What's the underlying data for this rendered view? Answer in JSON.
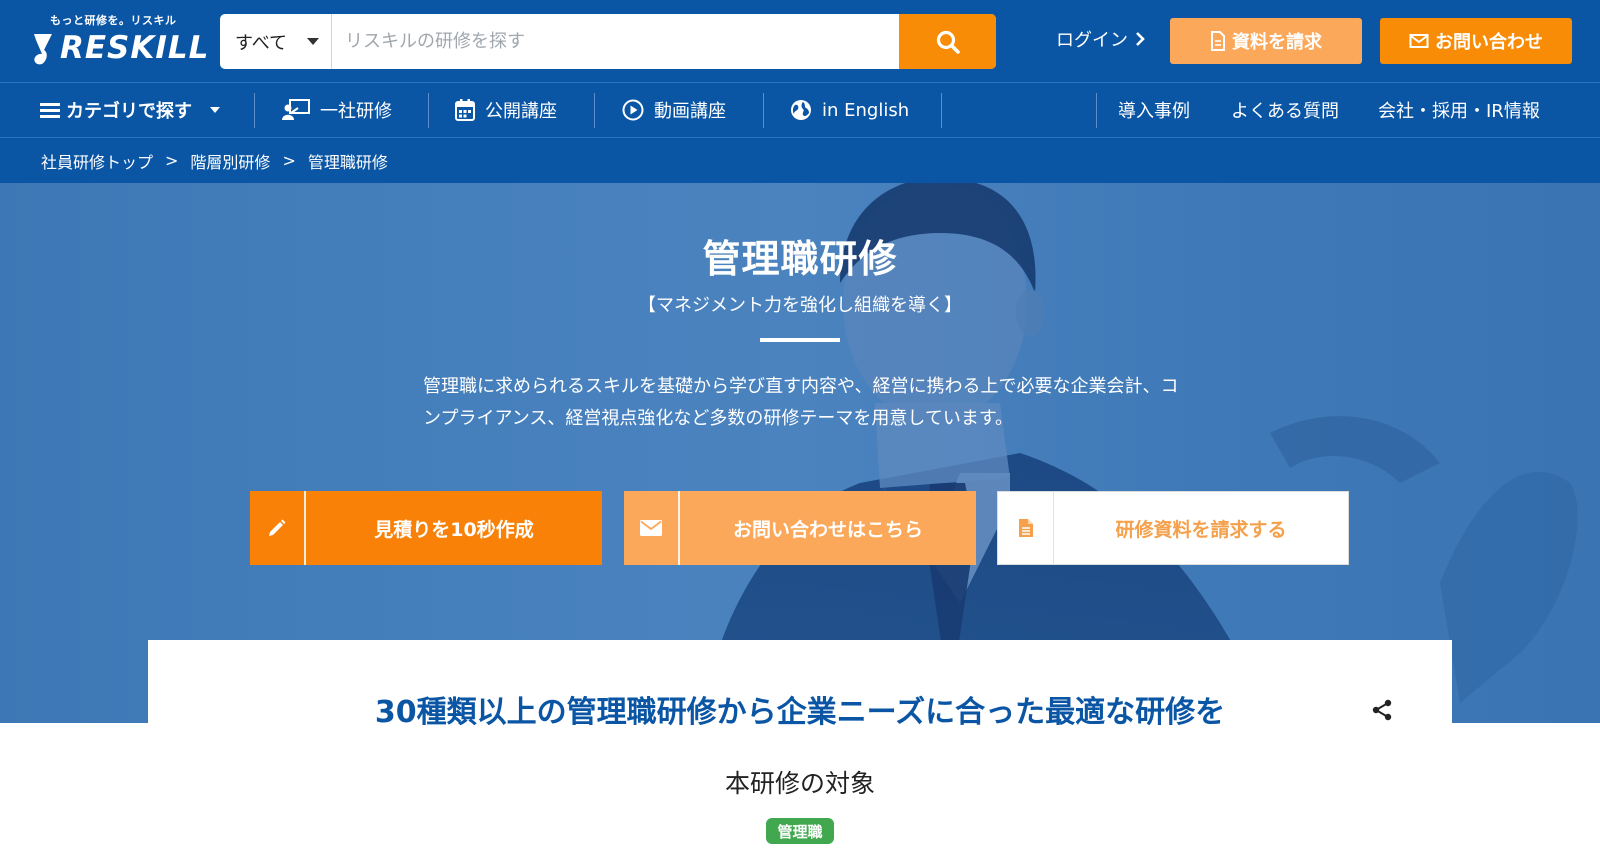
{
  "header": {
    "logo_tagline": "もっと研修を。リスキル",
    "logo_text": "RESKILL",
    "search": {
      "category": "すべて",
      "placeholder": "リスキルの研修を探す"
    },
    "login_label": "ログイン",
    "request_docs_label": "資料を請求",
    "contact_label": "お問い合わせ"
  },
  "nav": {
    "category": "カテゴリで探す",
    "items": [
      "一社研修",
      "公開講座",
      "動画講座",
      "in English"
    ],
    "right_items": [
      "導入事例",
      "よくある質問",
      "会社・採用・IR情報"
    ]
  },
  "breadcrumb": {
    "items": [
      "社員研修トップ",
      "階層別研修",
      "管理職研修"
    ],
    "separator": ">"
  },
  "hero": {
    "title": "管理職研修",
    "subtitle": "【マネジメント力を強化し組織を導く】",
    "description": "管理職に求められるスキルを基礎から学び直す内容や、経営に携わる上で必要な企業会計、コンプライアンス、経営視点強化など多数の研修テーマを用意しています。",
    "cta": {
      "estimate": "見積りを10秒作成",
      "inquiry": "お問い合わせはこちら",
      "request": "研修資料を請求する"
    }
  },
  "content": {
    "heading": "30種類以上の管理職研修から企業ニーズに合った最適な研修を",
    "target_title": "本研修の対象",
    "target_badge": "管理職"
  },
  "colors": {
    "brand_blue": "#0a56a5",
    "accent_orange": "#f98c07",
    "light_orange": "#fba85a",
    "badge_green": "#41a84f"
  }
}
